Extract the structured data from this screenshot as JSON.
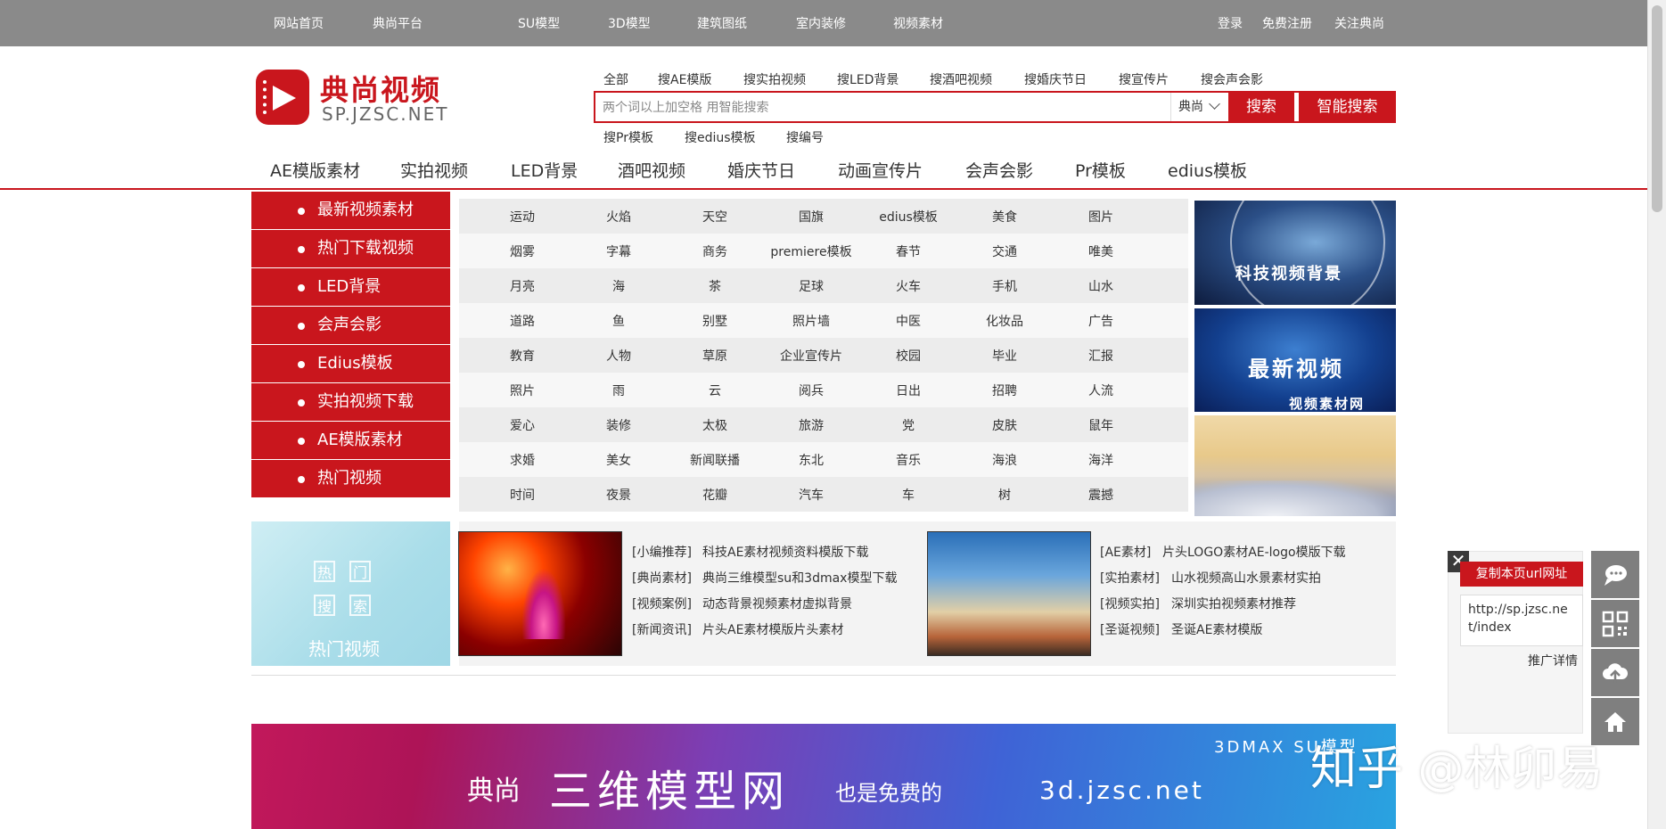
{
  "topbar": {
    "left_links": [
      "网站首页",
      "典尚平台",
      "SU模型",
      "3D模型",
      "建筑图纸",
      "室内装修",
      "视频素材"
    ],
    "right_links": [
      "登录",
      "免费注册",
      "关注典尚"
    ]
  },
  "logo": {
    "name": "典尚视频",
    "url": "SP.JZSC.NET"
  },
  "search": {
    "tabs": [
      "全部",
      "搜AE模版",
      "搜实拍视频",
      "搜LED背景",
      "搜酒吧视频",
      "搜婚庆节日",
      "搜宣传片",
      "搜会声会影"
    ],
    "placeholder": "两个词以上加空格 用智能搜索",
    "select_value": "典尚",
    "search_button": "搜索",
    "smart_button": "智能搜索",
    "bottom_links": [
      "搜Pr模板",
      "搜edius模板",
      "搜编号"
    ]
  },
  "category_nav": [
    "AE模版素材",
    "实拍视频",
    "LED背景",
    "酒吧视频",
    "婚庆节日",
    "动画宣传片",
    "会声会影",
    "Pr模板",
    "edius模板"
  ],
  "left_menu": [
    "最新视频素材",
    "热门下载视频",
    "LED背景",
    "会声会影",
    "Edius模板",
    "实拍视频下载",
    "AE模版素材",
    "热门视频"
  ],
  "tags": [
    [
      "运动",
      "火焰",
      "天空",
      "国旗",
      "edius模板",
      "美食",
      "图片"
    ],
    [
      "烟雾",
      "字幕",
      "商务",
      "premiere模板",
      "春节",
      "交通",
      "唯美"
    ],
    [
      "月亮",
      "海",
      "茶",
      "足球",
      "火车",
      "手机",
      "山水"
    ],
    [
      "道路",
      "鱼",
      "别墅",
      "照片墙",
      "中医",
      "化妆品",
      "广告"
    ],
    [
      "教育",
      "人物",
      "草原",
      "企业宣传片",
      "校园",
      "毕业",
      "汇报"
    ],
    [
      "照片",
      "雨",
      "云",
      "阅兵",
      "日出",
      "招聘",
      "人流"
    ],
    [
      "爱心",
      "装修",
      "太极",
      "旅游",
      "党",
      "皮肤",
      "鼠年"
    ],
    [
      "求婚",
      "美女",
      "新闻联播",
      "东北",
      "音乐",
      "海浪",
      "海洋"
    ],
    [
      "时间",
      "夜景",
      "花瓣",
      "汽车",
      "车",
      "树",
      "震撼"
    ]
  ],
  "banners": {
    "b1": "科技视频背景",
    "b2_title": "最新视频",
    "b2_sub": "视频素材网"
  },
  "hot_block": {
    "seal": [
      "热",
      "门",
      "搜",
      "索"
    ],
    "label": "热门视频"
  },
  "news_left": [
    {
      "tag": "[小编推荐]",
      "title": "科技AE素材视频资料模版下载"
    },
    {
      "tag": "[典尚素材]",
      "title": "典尚三维模型su和3dmax模型下载"
    },
    {
      "tag": "[视频案例]",
      "title": "动态背景视频素材虚拟背景"
    },
    {
      "tag": "[新闻资讯]",
      "title": "片头AE素材模版片头素材"
    }
  ],
  "news_right": [
    {
      "tag": "[AE素材]",
      "title": "片头LOGO素材AE-logo模版下载"
    },
    {
      "tag": "[实拍素材]",
      "title": "山水视频高山水景素材实拍"
    },
    {
      "tag": "[视频实拍]",
      "title": "深圳实拍视频素材推荐"
    },
    {
      "tag": "[圣诞视频]",
      "title": "圣诞AE素材模版"
    }
  ],
  "ad": {
    "brand": "典尚",
    "title": "三维模型网",
    "free": "也是免费的",
    "url": "3d.jzsc.net",
    "top_right": "3DMAX SU模型"
  },
  "float_panel": {
    "close": "✕",
    "copy_button": "复制本页url网址",
    "url_value": "http://sp.jzsc.net/index",
    "promo": "推广详情"
  },
  "sidetools": [
    "chat-icon",
    "qrcode-icon",
    "cloud-upload-icon",
    "home-icon"
  ],
  "watermark": "知乎 @林卯易"
}
